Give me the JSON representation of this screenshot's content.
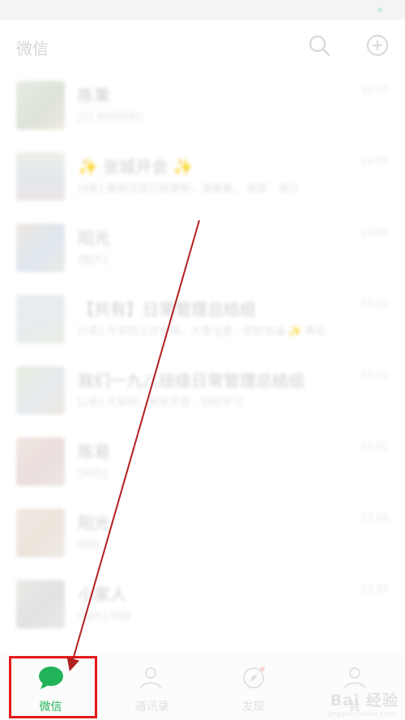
{
  "header": {
    "title": "微信"
  },
  "chats": [
    {
      "name": "陈果",
      "preview": "[1] 你好好的？",
      "time": "14:07"
    },
    {
      "name": "✨ 张城开会 ✨",
      "preview": "[4条] 最新动态已经更新，请查看… 我家 · 进行",
      "time": "14:05"
    },
    {
      "name": "阳光",
      "preview": "[图片]",
      "time": "14:04"
    },
    {
      "name": "【共有】日常管理总结组",
      "preview": "[5条] 今天的工作安排，大家注意 · 好好加油 ✨ 再见",
      "time": "14:03"
    },
    {
      "name": "我们一九八班级日常管理总结组",
      "preview": "[2条] 大家好，明天开会 · 好好学习",
      "time": "14:02"
    },
    {
      "name": "陈易",
      "preview": "[好的]",
      "time": "14:01"
    },
    {
      "name": "阳光",
      "preview": "好的",
      "time": "13:58"
    },
    {
      "name": "小家人",
      "preview": "[图片] 你好",
      "time": "13:55"
    }
  ],
  "tabs": [
    {
      "label": "微信"
    },
    {
      "label": "通讯录"
    },
    {
      "label": "发现"
    },
    {
      "label": "我"
    }
  ],
  "watermark": {
    "brand": "Bai 经验",
    "url": "jingyan.baidu.com"
  },
  "colors": {
    "accent": "#21b358",
    "highlight": "#e51919",
    "annotation_arrow": "#b21f1f"
  },
  "icons": {
    "search": "search-icon",
    "add": "plus-circle-icon",
    "chats_tab": "chat-bubble-icon",
    "contacts_tab": "contacts-icon",
    "discover_tab": "compass-icon",
    "me_tab": "person-icon"
  }
}
